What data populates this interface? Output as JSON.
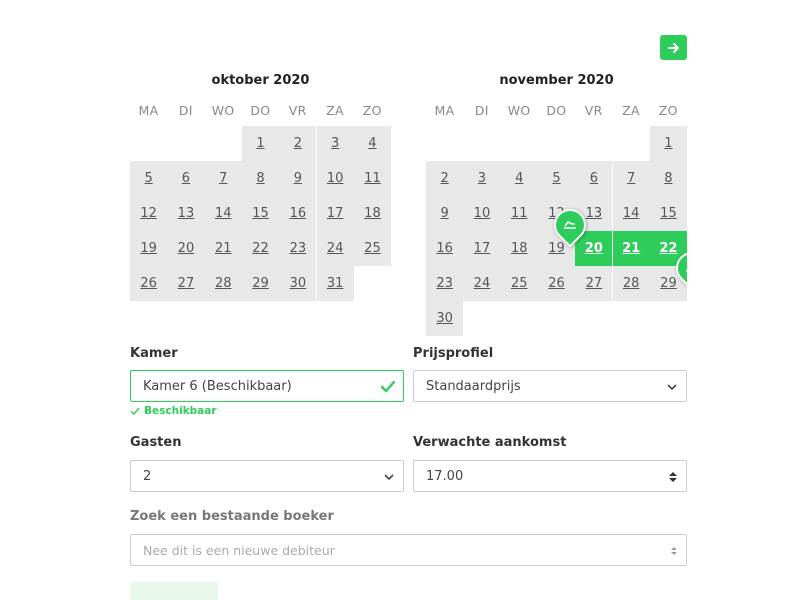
{
  "nav": {
    "next_icon": "arrow-right-icon",
    "accent": "#2ecc5a"
  },
  "calendar_oct": {
    "title": "oktober 2020",
    "weekdays": [
      "MA",
      "DI",
      "WO",
      "DO",
      "VR",
      "ZA",
      "ZO"
    ],
    "days": [
      "1",
      "2",
      "3",
      "4",
      "5",
      "6",
      "7",
      "8",
      "9",
      "10",
      "11",
      "12",
      "13",
      "14",
      "15",
      "16",
      "17",
      "18",
      "19",
      "20",
      "21",
      "22",
      "23",
      "24",
      "25",
      "26",
      "27",
      "28",
      "29",
      "30",
      "31"
    ]
  },
  "calendar_nov": {
    "title": "november 2020",
    "weekdays": [
      "MA",
      "DI",
      "WO",
      "DO",
      "VR",
      "ZA",
      "ZO"
    ],
    "days": [
      "1",
      "2",
      "3",
      "4",
      "5",
      "6",
      "7",
      "8",
      "9",
      "10",
      "11",
      "12",
      "13",
      "14",
      "15",
      "16",
      "17",
      "18",
      "19",
      "20",
      "21",
      "22",
      "23",
      "24",
      "25",
      "26",
      "27",
      "28",
      "29",
      "30"
    ],
    "selected": [
      "20",
      "21",
      "22"
    ],
    "markers": [
      "check-in-icon",
      "check-out-icon"
    ]
  },
  "form": {
    "room_label": "Kamer",
    "room_value": "Kamer 6 (Beschikbaar)",
    "room_status": "Beschikbaar",
    "price_label": "Prijsprofiel",
    "price_value": "Standaardprijs",
    "guests_label": "Gasten",
    "guests_value": "2",
    "arrival_label": "Verwachte aankomst",
    "arrival_value": "17.00",
    "booker_label": "Zoek een bestaande boeker",
    "booker_placeholder": "Nee dit is een nieuwe debiteur"
  }
}
